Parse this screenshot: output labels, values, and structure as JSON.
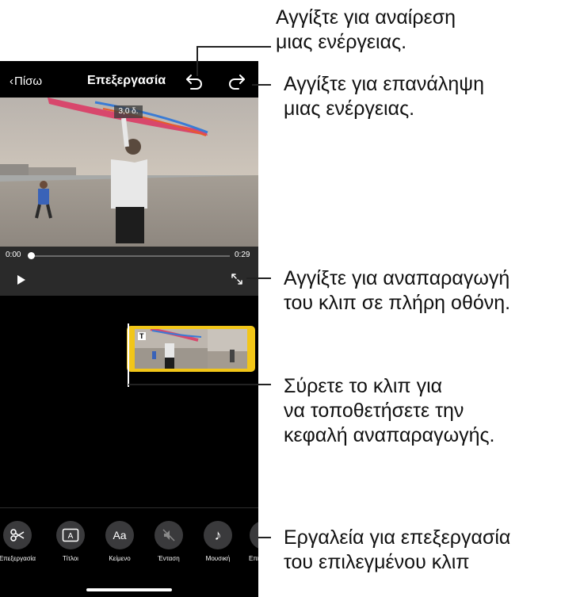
{
  "nav": {
    "back_label": "Πίσω",
    "title": "Επεξεργασία"
  },
  "video": {
    "duration_badge": "3,0 δ."
  },
  "player": {
    "current_time": "0:00",
    "total_time": "0:29",
    "progress": 0.0
  },
  "toolbar": {
    "tools": [
      {
        "label": "Επεξεργασία",
        "icon": "scissors-icon",
        "glyph": "✂"
      },
      {
        "label": "Τίτλοι",
        "icon": "titles-icon",
        "glyph": "A"
      },
      {
        "label": "Κείμενο",
        "icon": "text-icon",
        "glyph": "Aa"
      },
      {
        "label": "Ένταση",
        "icon": "volume-muted-icon",
        "glyph": ""
      },
      {
        "label": "Μουσική",
        "icon": "music-note-icon",
        "glyph": "♪"
      },
      {
        "label": "Επι",
        "icon": "more-tool-icon",
        "glyph": ""
      }
    ]
  },
  "clip": {
    "title_marker": "T"
  },
  "callouts": {
    "undo": [
      "Αγγίξτε για αναίρεση",
      "μιας ενέργειας."
    ],
    "redo": [
      "Αγγίξτε για επανάληψη",
      "μιας ενέργειας."
    ],
    "fullscreen": [
      "Αγγίξτε για αναπαραγωγή",
      "του κλιπ σε πλήρη οθόνη."
    ],
    "playhead": [
      "Σύρετε το κλιπ για",
      "να τοποθετήσετε την",
      "κεφαλή αναπαραγωγής."
    ],
    "tools": [
      "Εργαλεία για επεξεργασία",
      "του επιλεγμένου κλιπ"
    ]
  },
  "colors": {
    "clip_border": "#f2c618",
    "phone_bg": "#000000",
    "controls_bg": "#2a2a2a"
  }
}
